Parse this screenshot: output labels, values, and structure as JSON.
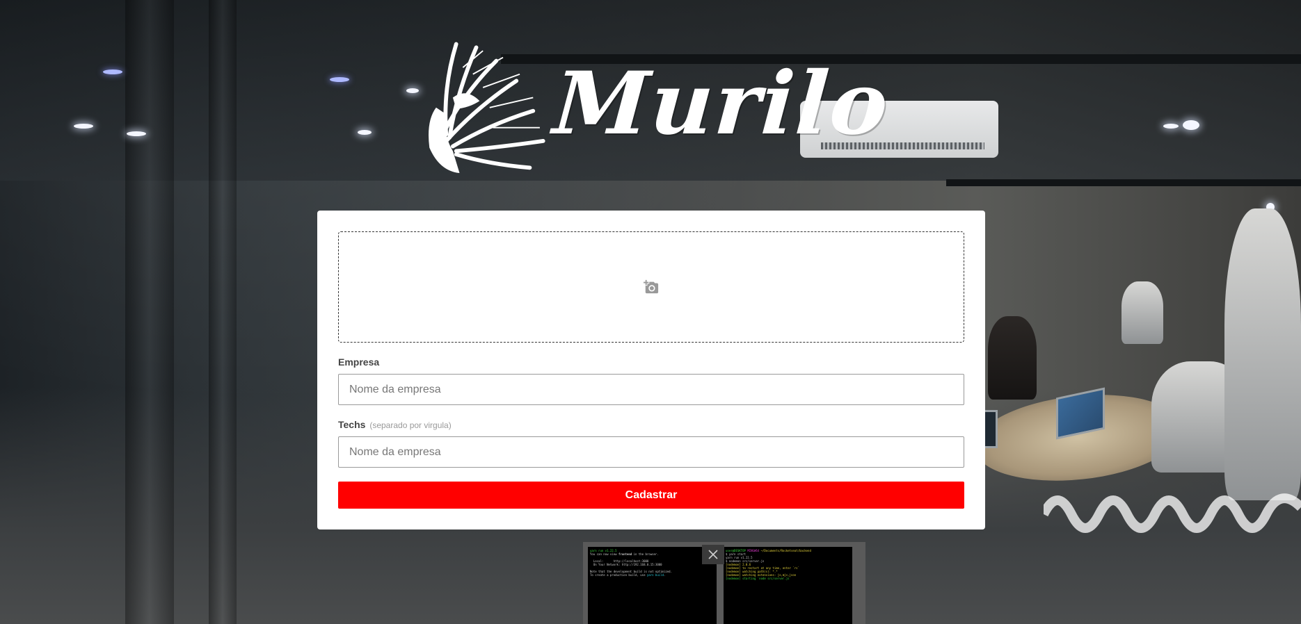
{
  "logo": {
    "wordmark": "Murilo",
    "icon": "native-headdress-icon"
  },
  "form": {
    "thumbnail_upload_icon": "add-photo-icon",
    "company": {
      "label": "Empresa",
      "placeholder": "Nome da empresa",
      "value": ""
    },
    "techs": {
      "label": "Techs",
      "hint": "(separado por virgula)",
      "placeholder": "Nome da empresa",
      "value": ""
    },
    "submit_label": "Cadastrar"
  },
  "colors": {
    "submit_bg": "#ff0000",
    "card_bg": "#ffffff"
  },
  "overlay": {
    "close_icon": "close-icon"
  }
}
